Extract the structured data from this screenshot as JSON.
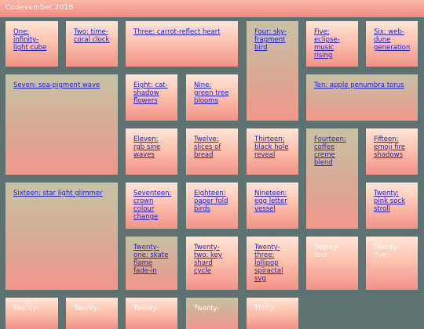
{
  "header": {
    "title": "Codevember 2018"
  },
  "tiles": [
    {
      "label": "One: infinity-light cube",
      "link": true,
      "tone": "warm"
    },
    {
      "label": "Two: time-coral clock",
      "link": true,
      "tone": "warm"
    },
    {
      "label": "Three: carrot-reflect heart",
      "link": true,
      "tone": "warm"
    },
    {
      "label": "Four: sky-fragment bird",
      "link": true,
      "tone": "cool"
    },
    {
      "label": "Five: eclipse-music rising",
      "link": true,
      "tone": "warm"
    },
    {
      "label": "Six: web-dune generation",
      "link": true,
      "tone": "warm"
    },
    {
      "label": "Seven: sea-pigment wave",
      "link": true,
      "tone": "cool"
    },
    {
      "label": "Eight: cat-shadow flowers",
      "link": true,
      "tone": "warm"
    },
    {
      "label": "Nine: green tree blooms",
      "link": true,
      "tone": "warm"
    },
    {
      "label": "Ten: apple penumbra torus",
      "link": true,
      "tone": "cool"
    },
    {
      "label": "Eleven: rgb sine waves",
      "link": true,
      "tone": "warm"
    },
    {
      "label": "Twelve: slices of bread",
      "link": true,
      "tone": "warm"
    },
    {
      "label": "Thirteen: black hole reveal",
      "link": true,
      "tone": "warm"
    },
    {
      "label": "Fourteen: coffee creme blend",
      "link": true,
      "tone": "cool"
    },
    {
      "label": "Fifteen: emoji fire shadows",
      "link": true,
      "tone": "warm"
    },
    {
      "label": "Sixteen: star light glimmer",
      "link": true,
      "tone": "cool"
    },
    {
      "label": "Seventeen: crown colour change",
      "link": true,
      "tone": "warm"
    },
    {
      "label": "Eighteen: paper fold birds",
      "link": true,
      "tone": "warm"
    },
    {
      "label": "Nineteen: egg letter vessel",
      "link": true,
      "tone": "warm"
    },
    {
      "label": "Twenty: pink sock stroll",
      "link": true,
      "tone": "warm"
    },
    {
      "label": "Twenty-one: skate flame fade-in",
      "link": true,
      "tone": "cool"
    },
    {
      "label": "Twenty-two: key shard cycle",
      "link": true,
      "tone": "warm"
    },
    {
      "label": "Twenty-three: lollipop spiractal svg",
      "link": true,
      "tone": "warm"
    },
    {
      "label": "Twenty-four",
      "link": false,
      "tone": "warm"
    },
    {
      "label": "Twenty-five",
      "link": false,
      "tone": "warm"
    },
    {
      "label": "Twenty-",
      "link": false,
      "tone": "warm"
    },
    {
      "label": "Twenty-",
      "link": false,
      "tone": "warm"
    },
    {
      "label": "Twenty-",
      "link": false,
      "tone": "warm"
    },
    {
      "label": "Twenty-",
      "link": false,
      "tone": "cool"
    },
    {
      "label": "Thirty",
      "link": false,
      "tone": "warm"
    }
  ]
}
